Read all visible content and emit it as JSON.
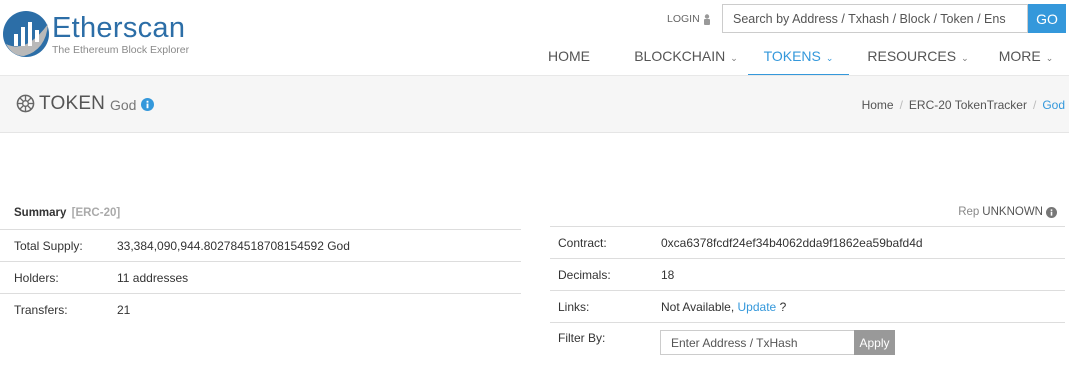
{
  "brand": {
    "name": "Etherscan",
    "tagline": "The Ethereum Block Explorer",
    "color": "#2c6ea7"
  },
  "header": {
    "login_label": "LOGIN",
    "search_placeholder": "Search by Address / Txhash / Block / Token / Ens",
    "go_label": "GO"
  },
  "nav": {
    "items": [
      {
        "label": "HOME",
        "has_dropdown": false
      },
      {
        "label": "BLOCKCHAIN",
        "has_dropdown": true
      },
      {
        "label": "TOKENS",
        "has_dropdown": true,
        "active": true
      },
      {
        "label": "RESOURCES",
        "has_dropdown": true
      },
      {
        "label": "MORE",
        "has_dropdown": true
      }
    ],
    "accent": "#3498db"
  },
  "page": {
    "title": "TOKEN",
    "subtitle": "God",
    "breadcrumb": [
      "Home",
      "ERC-20 TokenTracker",
      "God"
    ]
  },
  "summary": {
    "title": "Summary",
    "standard": "[ERC-20]",
    "rep_label": "Rep",
    "rep_value": "UNKNOWN",
    "left_rows": [
      {
        "label": "Total Supply:",
        "value": "33,384,090,944.802784518708154592 God"
      },
      {
        "label": "Holders:",
        "value": "11 addresses"
      },
      {
        "label": "Transfers:",
        "value": "21"
      }
    ],
    "contract_label": "Contract:",
    "contract_value": "0xca6378fcdf24ef34b4062dda9f1862ea59bafd4d",
    "decimals_label": "Decimals:",
    "decimals_value": "18",
    "links_label": "Links:",
    "links_value": "Not Available,",
    "links_update": "Update",
    "links_q": "?",
    "filter_label": "Filter By:",
    "filter_placeholder": "Enter Address / TxHash",
    "apply_label": "Apply"
  }
}
